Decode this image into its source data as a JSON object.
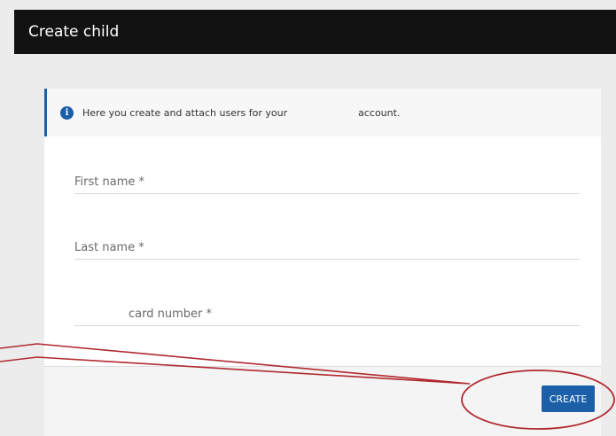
{
  "header": {
    "title": "Create child"
  },
  "info": {
    "text_part1": "Here you create and attach users for your",
    "text_part2": "account.",
    "icon": "info-icon",
    "accent_color": "#1a5fa8"
  },
  "form": {
    "first_name": {
      "placeholder": "First name *",
      "value": ""
    },
    "last_name": {
      "placeholder": "Last name *",
      "value": ""
    },
    "card_number": {
      "placeholder": "card number *",
      "value": ""
    }
  },
  "footer": {
    "create_label": "CREATE"
  },
  "colors": {
    "header_bg": "#121212",
    "primary_button": "#1a5fa8",
    "annotation": "#b02a30"
  }
}
